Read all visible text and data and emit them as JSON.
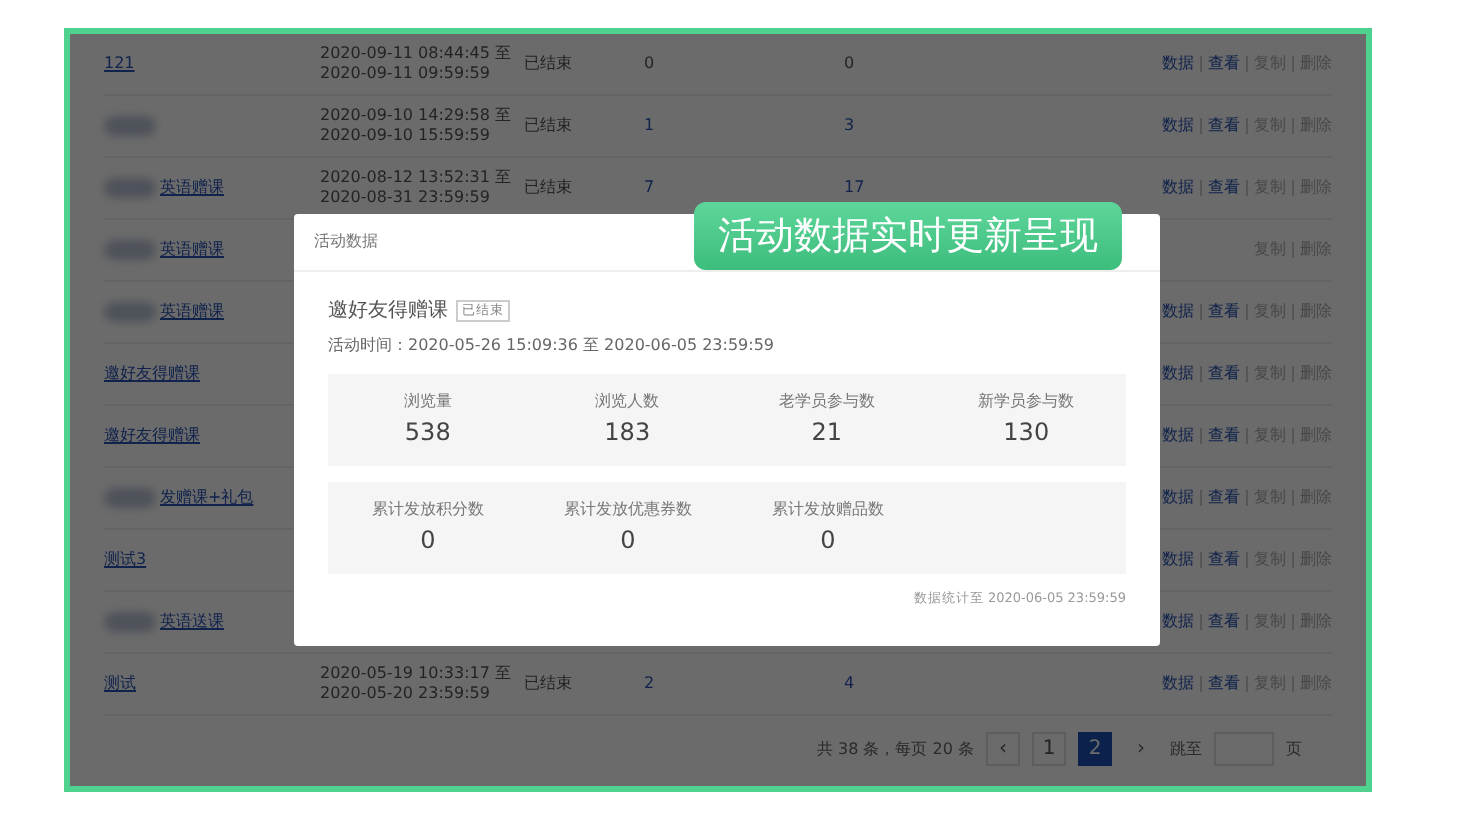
{
  "table": {
    "rows": [
      {
        "name": "121",
        "redacted": false,
        "time_start": "2020-09-11 08:44:45 至",
        "time_end": "2020-09-11 09:59:59",
        "status": "已结束",
        "participants": {
          "text": "0",
          "link": false
        },
        "orders": {
          "text": "0",
          "link": false
        },
        "actions": [
          {
            "label": "数据",
            "disabled": false
          },
          {
            "label": "查看",
            "disabled": false
          },
          {
            "label": "复制",
            "disabled": true
          },
          {
            "label": "删除",
            "disabled": true
          }
        ]
      },
      {
        "redacted": true,
        "time_start": "2020-09-10 14:29:58 至",
        "time_end": "2020-09-10 15:59:59",
        "status": "已结束",
        "participants": {
          "text": "1",
          "link": true
        },
        "orders": {
          "text": "3",
          "link": true
        },
        "actions": [
          {
            "label": "数据",
            "disabled": false
          },
          {
            "label": "查看",
            "disabled": false
          },
          {
            "label": "复制",
            "disabled": true
          },
          {
            "label": "删除",
            "disabled": true
          }
        ]
      },
      {
        "name": "英语赠课",
        "redacted": true,
        "time_start": "2020-08-12 13:52:31 至",
        "time_end": "2020-08-31 23:59:59",
        "status": "已结束",
        "participants": {
          "text": "7",
          "link": true
        },
        "orders": {
          "text": "17",
          "link": true
        },
        "actions": [
          {
            "label": "数据",
            "disabled": false
          },
          {
            "label": "查看",
            "disabled": false
          },
          {
            "label": "复制",
            "disabled": true
          },
          {
            "label": "删除",
            "disabled": true
          }
        ]
      },
      {
        "name": "英语赠课",
        "redacted": true,
        "actions": [
          {
            "label": "复制",
            "disabled": true
          },
          {
            "label": "删除",
            "disabled": true
          }
        ]
      },
      {
        "name": "英语赠课",
        "redacted": true,
        "actions": [
          {
            "label": "数据",
            "disabled": false
          },
          {
            "label": "查看",
            "disabled": false
          },
          {
            "label": "复制",
            "disabled": true
          },
          {
            "label": "删除",
            "disabled": true
          }
        ]
      },
      {
        "name": "邀好友得赠课",
        "redacted": false,
        "actions": [
          {
            "label": "数据",
            "disabled": false
          },
          {
            "label": "查看",
            "disabled": false
          },
          {
            "label": "复制",
            "disabled": true
          },
          {
            "label": "删除",
            "disabled": true
          }
        ]
      },
      {
        "name": "邀好友得赠课",
        "redacted": false,
        "actions": [
          {
            "label": "数据",
            "disabled": false
          },
          {
            "label": "查看",
            "disabled": false
          },
          {
            "label": "复制",
            "disabled": true
          },
          {
            "label": "删除",
            "disabled": true
          }
        ]
      },
      {
        "name": "发赠课+礼包",
        "redacted": true,
        "actions": [
          {
            "label": "数据",
            "disabled": false
          },
          {
            "label": "查看",
            "disabled": false
          },
          {
            "label": "复制",
            "disabled": true
          },
          {
            "label": "删除",
            "disabled": true
          }
        ]
      },
      {
        "name": "测试3",
        "redacted": false,
        "actions": [
          {
            "label": "数据",
            "disabled": false
          },
          {
            "label": "查看",
            "disabled": false
          },
          {
            "label": "复制",
            "disabled": true
          },
          {
            "label": "删除",
            "disabled": true
          }
        ]
      },
      {
        "name": "英语送课",
        "redacted": true,
        "actions": [
          {
            "label": "数据",
            "disabled": false
          },
          {
            "label": "查看",
            "disabled": false
          },
          {
            "label": "复制",
            "disabled": true
          },
          {
            "label": "删除",
            "disabled": true
          }
        ]
      },
      {
        "name": "测试",
        "redacted": false,
        "time_start": "2020-05-19 10:33:17 至",
        "time_end": "2020-05-20 23:59:59",
        "status": "已结束",
        "participants": {
          "text": "2",
          "link": true
        },
        "orders": {
          "text": "4",
          "link": true
        },
        "actions": [
          {
            "label": "数据",
            "disabled": false
          },
          {
            "label": "查看",
            "disabled": false
          },
          {
            "label": "复制",
            "disabled": true
          },
          {
            "label": "删除",
            "disabled": true
          }
        ]
      }
    ]
  },
  "pagination": {
    "summary": "共 38 条，每页 20 条",
    "prev": "‹",
    "pages": [
      {
        "label": "1",
        "selected": false
      },
      {
        "label": "2",
        "selected": true
      }
    ],
    "next": "›",
    "next_disabled": true,
    "jump_label": "跳至",
    "jump_suffix": "页"
  },
  "modal": {
    "title": "活动数据",
    "activity_name": "邀好友得赠课",
    "tag": "已结束",
    "time": "活动时间：2020-05-26 15:09:36 至 2020-06-05 23:59:59",
    "stat_groups": [
      [
        {
          "label": "浏览量",
          "value": "538"
        },
        {
          "label": "浏览人数",
          "value": "183"
        },
        {
          "label": "老学员参与数",
          "value": "21"
        },
        {
          "label": "新学员参与数",
          "value": "130"
        }
      ],
      [
        {
          "label": "累计发放积分数",
          "value": "0"
        },
        {
          "label": "累计发放优惠券数",
          "value": "0"
        },
        {
          "label": "累计发放赠品数",
          "value": "0"
        }
      ]
    ],
    "footer": "数据统计至 2020-06-05 23:59:59"
  },
  "banner": "活动数据实时更新呈现"
}
